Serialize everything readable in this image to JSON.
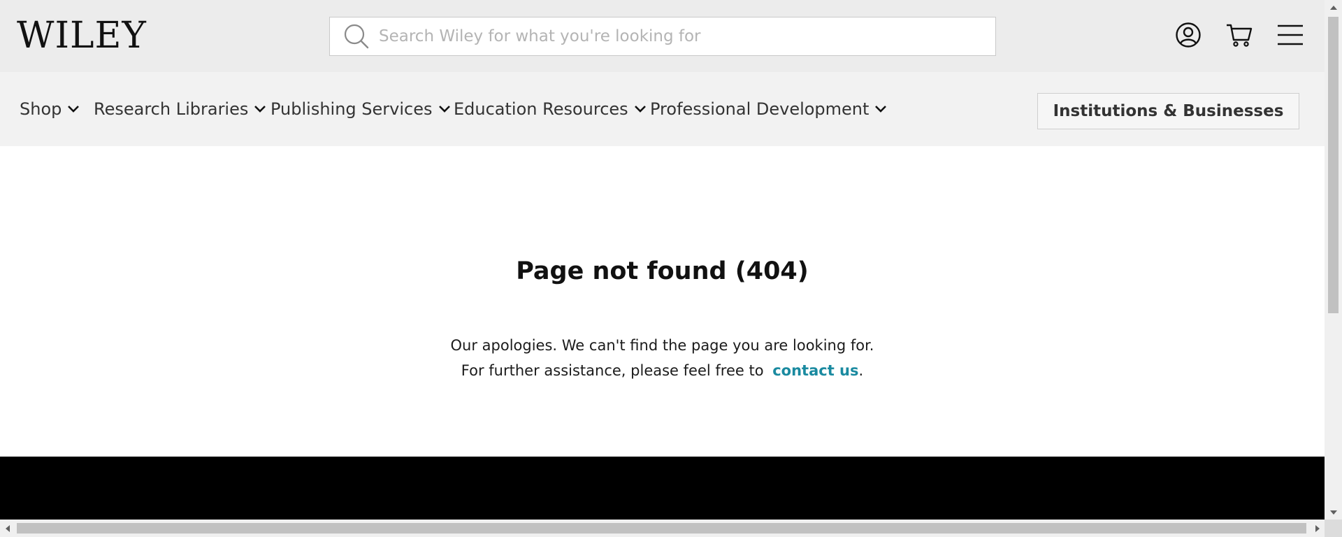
{
  "header": {
    "logo_text": "WILEY",
    "search": {
      "placeholder": "Search Wiley for what you're looking for",
      "value": ""
    },
    "icons": [
      "account-icon",
      "cart-icon",
      "menu-icon"
    ]
  },
  "nav": {
    "items": [
      {
        "label": "Shop"
      },
      {
        "label": "Research Libraries"
      },
      {
        "label": "Publishing Services"
      },
      {
        "label": "Education Resources"
      },
      {
        "label": "Professional Development"
      }
    ],
    "institutions_button": "Institutions & Businesses"
  },
  "main": {
    "title": "Page not found (404)",
    "line1": "Our apologies. We can't find the page you are looking for.",
    "line2_prefix": "For further assistance, please feel free to ",
    "contact_link": "contact us",
    "line2_suffix": "."
  },
  "colors": {
    "header_bg": "#ececec",
    "nav_bg": "#f2f2f2",
    "link": "#1a8aa0",
    "footer_bg": "#000000"
  }
}
